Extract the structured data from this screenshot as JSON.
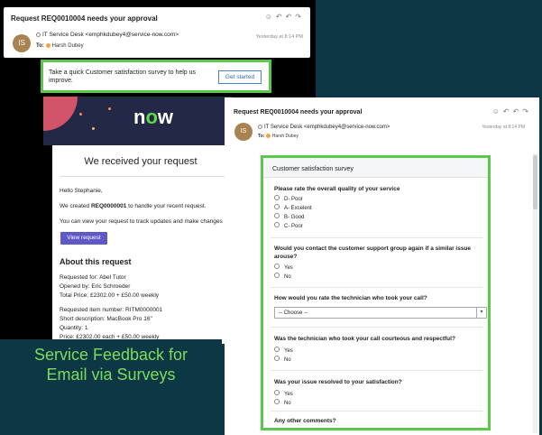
{
  "email1": {
    "subject": "Request REQ0010004 needs your approval",
    "avatar": "IS",
    "from": "IT Service Desk <emphkdubey4@service-now.com>",
    "to_label": "To:",
    "to": "Harsh Dubey",
    "time": "Yesterday at 8:14 PM",
    "actions": "☺↶↶↷"
  },
  "banner": {
    "text": "Take a quick Customer satisfaction survey to help us improve.",
    "button": "Get started"
  },
  "now_email": {
    "logo_pre": "n",
    "logo_o": "o",
    "logo_post": "w",
    "heading": "We received your request",
    "greeting": "Hello Stephanie,",
    "line1_pre": "We created ",
    "line1_req": "REQ0000001",
    "line1_post": " to handle your recent request.",
    "line2": "You can view your request to track updates and make changes",
    "view_button": "View request",
    "about": "About this request",
    "requested_for": "Requested for: Abel Tutor",
    "opened_by": "Opened by: Eric Schroeder",
    "total_price": "Total Price: £2302.00  + £50.00 weekly",
    "item_number": "Requested item number: RITM0000001",
    "short_desc": "Short description: MacBook Pro 16\"",
    "quantity": "Quantity: 1",
    "price": "Price: £2302.00 each + £50.00 weekly"
  },
  "tagline": {
    "line1": "Service Feedback for",
    "line2": "Email via Surveys"
  },
  "email2": {
    "subject": "Request REQ0010004 needs your approval",
    "avatar": "IS",
    "from": "IT Service Desk <emphkdubey4@service-now.com>",
    "to_label": "To:",
    "to": "Harsh Dubey",
    "time": "Yesterday at 8:14 PM",
    "actions": "☺↶↶↷"
  },
  "survey": {
    "title": "Customer satisfaction survey",
    "q1": "Please rate the overall quality of your service",
    "q1_options": [
      "D- Poor",
      "A- Excelent",
      "B- Good",
      "C- Poor"
    ],
    "q2": "Would you contact the customer support group again if a similar issue arouse?",
    "q2_options": [
      "Yes",
      "No"
    ],
    "q3": "How would you rate the technician who took your call?",
    "q3_select": "-- Choose --",
    "q4": "Was the technician who took your call courteous and respectful?",
    "q4_options": [
      "Yes",
      "No"
    ],
    "q5": "Was your issue resolved to your satisfaction?",
    "q5_options": [
      "Yes",
      "No"
    ],
    "q6": "Any other comments?"
  },
  "colors": {
    "highlight_green": "#5ac84a",
    "background": "#0c3745",
    "now_header": "#232847",
    "view_button": "#5f58c6",
    "tagline": "#7fdc5a"
  }
}
